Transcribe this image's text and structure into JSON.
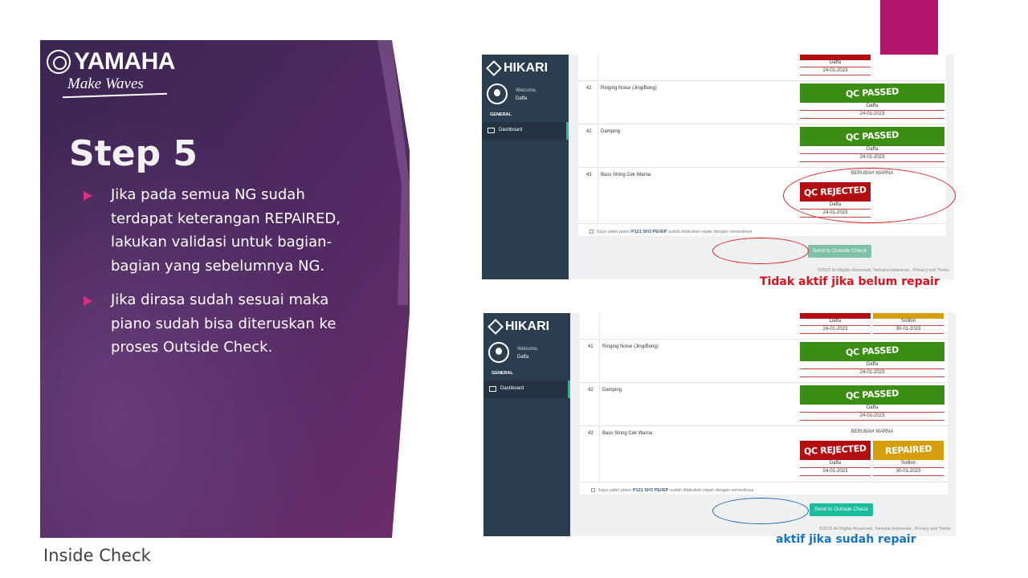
{
  "brand": {
    "name": "YAMAHA",
    "tagline": "Make Waves"
  },
  "slide": {
    "title": "Step 5",
    "bullets": [
      "Jika pada semua NG sudah terdapat keterangan REPAIRED, lakukan validasi untuk bagian-bagian yang sebelumnya NG.",
      "Jika dirasa sudah sesuai maka piano sudah bisa diteruskan ke proses Outside Check."
    ],
    "footer": "Inside Check"
  },
  "colors": {
    "accent": "#b5156a",
    "sidebar": "#2b3e50",
    "qc_passed": "#3b8d13",
    "qc_rejected": "#b30f12",
    "repaired": "#d49e0c",
    "button": "#1abc9c"
  },
  "app": {
    "name": "HIKARI",
    "welcome": "Welcome,",
    "user": "Daffa",
    "section": "GENERAL",
    "nav_dashboard": "Dashboard",
    "copyright": "©2022 All Rights Reserved. Yamaha Indonesia . Privacy and Terms",
    "confirm_prefix": "Saya yakin piano",
    "confirm_model": "P121 SH3 PE//EP",
    "confirm_suffix": "sudah dilakukan repair dengan semestinya",
    "send_button": "Send to Outside Check"
  },
  "shot1": {
    "top_partial": {
      "name": "Daffa",
      "date": "24-01-2023"
    },
    "rows": [
      {
        "no": "41",
        "name": "Ringing Noise (Jing/Bong)",
        "status": "QC PASSED",
        "by": "Daffa",
        "date": "24-01-2023"
      },
      {
        "no": "42",
        "name": "Damping",
        "status": "QC PASSED",
        "by": "Daffa",
        "date": "24-01-2023"
      },
      {
        "no": "43",
        "name": "Bass String Cek Warna",
        "note": "BERUBAH WARNA",
        "status": "QC REJECTED",
        "by": "Daffa",
        "date": "24-01-2023"
      }
    ],
    "caption": "Tidak aktif jika belum repair"
  },
  "shot2": {
    "top_partial": [
      {
        "name": "Daffa",
        "date": "24-01-2023"
      },
      {
        "name": "Solihin",
        "date": "30-01-2023"
      }
    ],
    "rows": [
      {
        "no": "41",
        "name": "Ringing Noise (Jing/Bong)",
        "status": "QC PASSED",
        "by": "Daffa",
        "date": "24-01-2023"
      },
      {
        "no": "42",
        "name": "Damping",
        "status": "QC PASSED",
        "by": "Daffa",
        "date": "24-01-2023"
      },
      {
        "no": "43",
        "name": "Bass String Cek Warna",
        "note": "BERUBAH WARNA",
        "status": "QC REJECTED",
        "by": "Daffa",
        "date": "24-01-2023",
        "status2": "REPAIRED",
        "by2": "Solihin",
        "date2": "30-01-2023"
      }
    ],
    "caption": "aktif jika sudah repair"
  }
}
